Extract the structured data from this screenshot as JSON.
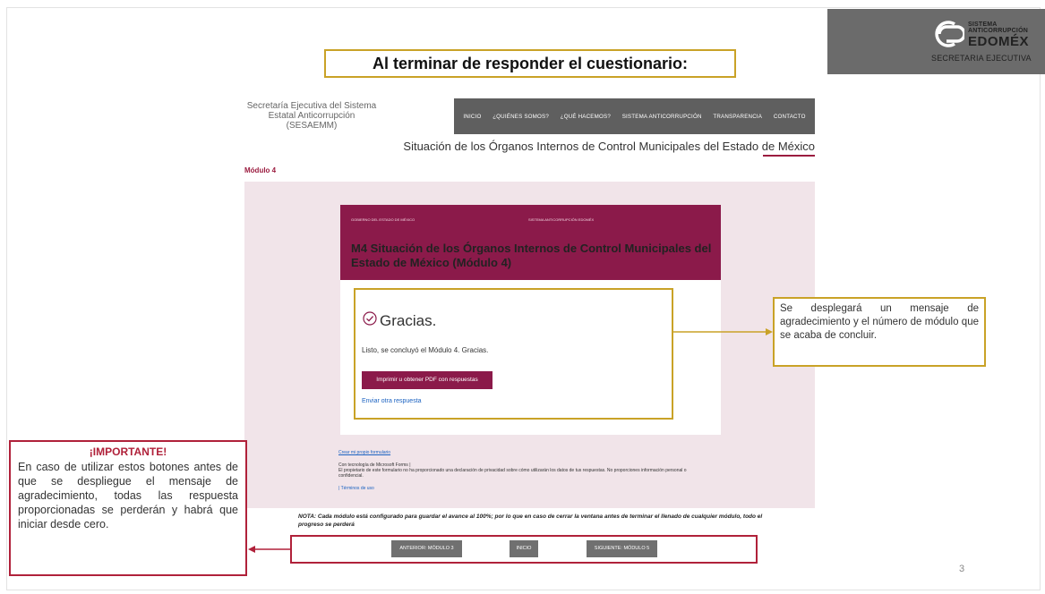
{
  "logo": {
    "line1": "SISTEMA",
    "line2": "ANTICORRUPCIÓN",
    "line3": "EDOMÉX",
    "line4": "SECRETARIA EJECUTIVA"
  },
  "slide_title": "Al terminar de responder el cuestionario:",
  "site": {
    "name": "Secretaría Ejecutiva del Sistema Estatal Anticorrupción (SESAEMM)",
    "nav": [
      "INICIO",
      "¿QUIÉNES SOMOS?",
      "¿QUÉ HACEMOS?",
      "SISTEMA ANTICORRUPCIÓN",
      "TRANSPARENCIA",
      "CONTACTO"
    ],
    "subtitle": "Situación de los Órganos Internos de Control Municipales del Estado de México",
    "module_label": "Módulo 4"
  },
  "form": {
    "header_small_left": "GOBIERNO DEL ESTADO DE MÉXICO",
    "header_small_right": "SISTEMA ANTICORRUPCIÓN EDOMÉX",
    "title": "M4 Situación de los Órganos Internos de Control Municipales del Estado de México (Módulo 4)",
    "thanks_title": "Gracias.",
    "thanks_message": "Listo, se concluyó el Módulo 4. Gracias.",
    "pdf_button": "Imprimir u obtener PDF con respuestas",
    "another_link": "Enviar otra respuesta",
    "footer_link": "Crear mi propio formulario",
    "footer_tech": "Con tecnología de Microsoft Forms |",
    "footer_privacy": "El propietario de este formulario no ha proporcionado una declaración de privacidad sobre cómo utilizarán los datos de tus respuestas. No proporciones información personal o confidencial.",
    "footer_terms": "| Términos de uso"
  },
  "nota": "NOTA: Cada módulo está configurado para guardar el avance al 100%; por lo que en caso de cerrar la ventana antes de terminar el llenado de cualquier módulo, todo el progreso se perderá",
  "nav_buttons": {
    "prev": "ANTERIOR: MÓDULO 3",
    "home": "INICIO",
    "next": "SIGUIENTE: MÓDULO 5"
  },
  "callout_right": "Se desplegará un mensaje de agradecimiento y el número de módulo que se acaba de concluir.",
  "callout_left": {
    "title": "¡IMPORTANTE!",
    "body": "En caso de utilizar estos botones antes de que se despliegue el mensaje de agradecimiento, todas las respuesta proporcionadas se perderán y habrá que iniciar desde cero."
  },
  "page_number": "3",
  "colors": {
    "accent_gold": "#c9a227",
    "accent_red": "#b0213a",
    "form_header": "#8b1a4a",
    "nav_bg": "#5f5f5f"
  }
}
